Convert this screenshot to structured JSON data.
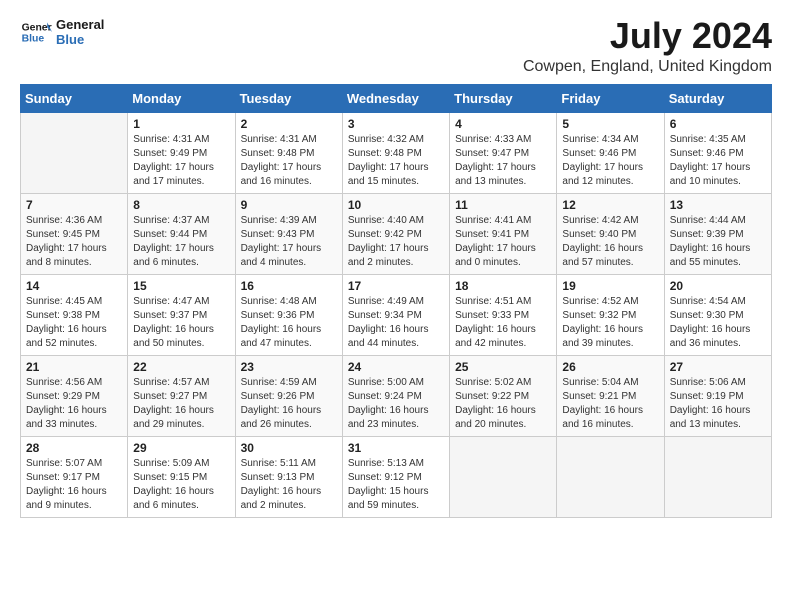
{
  "header": {
    "logo_line1": "General",
    "logo_line2": "Blue",
    "month_year": "July 2024",
    "location": "Cowpen, England, United Kingdom"
  },
  "days_of_week": [
    "Sunday",
    "Monday",
    "Tuesday",
    "Wednesday",
    "Thursday",
    "Friday",
    "Saturday"
  ],
  "weeks": [
    [
      {
        "num": "",
        "empty": true
      },
      {
        "num": "1",
        "sunrise": "Sunrise: 4:31 AM",
        "sunset": "Sunset: 9:49 PM",
        "daylight": "Daylight: 17 hours and 17 minutes."
      },
      {
        "num": "2",
        "sunrise": "Sunrise: 4:31 AM",
        "sunset": "Sunset: 9:48 PM",
        "daylight": "Daylight: 17 hours and 16 minutes."
      },
      {
        "num": "3",
        "sunrise": "Sunrise: 4:32 AM",
        "sunset": "Sunset: 9:48 PM",
        "daylight": "Daylight: 17 hours and 15 minutes."
      },
      {
        "num": "4",
        "sunrise": "Sunrise: 4:33 AM",
        "sunset": "Sunset: 9:47 PM",
        "daylight": "Daylight: 17 hours and 13 minutes."
      },
      {
        "num": "5",
        "sunrise": "Sunrise: 4:34 AM",
        "sunset": "Sunset: 9:46 PM",
        "daylight": "Daylight: 17 hours and 12 minutes."
      },
      {
        "num": "6",
        "sunrise": "Sunrise: 4:35 AM",
        "sunset": "Sunset: 9:46 PM",
        "daylight": "Daylight: 17 hours and 10 minutes."
      }
    ],
    [
      {
        "num": "7",
        "sunrise": "Sunrise: 4:36 AM",
        "sunset": "Sunset: 9:45 PM",
        "daylight": "Daylight: 17 hours and 8 minutes."
      },
      {
        "num": "8",
        "sunrise": "Sunrise: 4:37 AM",
        "sunset": "Sunset: 9:44 PM",
        "daylight": "Daylight: 17 hours and 6 minutes."
      },
      {
        "num": "9",
        "sunrise": "Sunrise: 4:39 AM",
        "sunset": "Sunset: 9:43 PM",
        "daylight": "Daylight: 17 hours and 4 minutes."
      },
      {
        "num": "10",
        "sunrise": "Sunrise: 4:40 AM",
        "sunset": "Sunset: 9:42 PM",
        "daylight": "Daylight: 17 hours and 2 minutes."
      },
      {
        "num": "11",
        "sunrise": "Sunrise: 4:41 AM",
        "sunset": "Sunset: 9:41 PM",
        "daylight": "Daylight: 17 hours and 0 minutes."
      },
      {
        "num": "12",
        "sunrise": "Sunrise: 4:42 AM",
        "sunset": "Sunset: 9:40 PM",
        "daylight": "Daylight: 16 hours and 57 minutes."
      },
      {
        "num": "13",
        "sunrise": "Sunrise: 4:44 AM",
        "sunset": "Sunset: 9:39 PM",
        "daylight": "Daylight: 16 hours and 55 minutes."
      }
    ],
    [
      {
        "num": "14",
        "sunrise": "Sunrise: 4:45 AM",
        "sunset": "Sunset: 9:38 PM",
        "daylight": "Daylight: 16 hours and 52 minutes."
      },
      {
        "num": "15",
        "sunrise": "Sunrise: 4:47 AM",
        "sunset": "Sunset: 9:37 PM",
        "daylight": "Daylight: 16 hours and 50 minutes."
      },
      {
        "num": "16",
        "sunrise": "Sunrise: 4:48 AM",
        "sunset": "Sunset: 9:36 PM",
        "daylight": "Daylight: 16 hours and 47 minutes."
      },
      {
        "num": "17",
        "sunrise": "Sunrise: 4:49 AM",
        "sunset": "Sunset: 9:34 PM",
        "daylight": "Daylight: 16 hours and 44 minutes."
      },
      {
        "num": "18",
        "sunrise": "Sunrise: 4:51 AM",
        "sunset": "Sunset: 9:33 PM",
        "daylight": "Daylight: 16 hours and 42 minutes."
      },
      {
        "num": "19",
        "sunrise": "Sunrise: 4:52 AM",
        "sunset": "Sunset: 9:32 PM",
        "daylight": "Daylight: 16 hours and 39 minutes."
      },
      {
        "num": "20",
        "sunrise": "Sunrise: 4:54 AM",
        "sunset": "Sunset: 9:30 PM",
        "daylight": "Daylight: 16 hours and 36 minutes."
      }
    ],
    [
      {
        "num": "21",
        "sunrise": "Sunrise: 4:56 AM",
        "sunset": "Sunset: 9:29 PM",
        "daylight": "Daylight: 16 hours and 33 minutes."
      },
      {
        "num": "22",
        "sunrise": "Sunrise: 4:57 AM",
        "sunset": "Sunset: 9:27 PM",
        "daylight": "Daylight: 16 hours and 29 minutes."
      },
      {
        "num": "23",
        "sunrise": "Sunrise: 4:59 AM",
        "sunset": "Sunset: 9:26 PM",
        "daylight": "Daylight: 16 hours and 26 minutes."
      },
      {
        "num": "24",
        "sunrise": "Sunrise: 5:00 AM",
        "sunset": "Sunset: 9:24 PM",
        "daylight": "Daylight: 16 hours and 23 minutes."
      },
      {
        "num": "25",
        "sunrise": "Sunrise: 5:02 AM",
        "sunset": "Sunset: 9:22 PM",
        "daylight": "Daylight: 16 hours and 20 minutes."
      },
      {
        "num": "26",
        "sunrise": "Sunrise: 5:04 AM",
        "sunset": "Sunset: 9:21 PM",
        "daylight": "Daylight: 16 hours and 16 minutes."
      },
      {
        "num": "27",
        "sunrise": "Sunrise: 5:06 AM",
        "sunset": "Sunset: 9:19 PM",
        "daylight": "Daylight: 16 hours and 13 minutes."
      }
    ],
    [
      {
        "num": "28",
        "sunrise": "Sunrise: 5:07 AM",
        "sunset": "Sunset: 9:17 PM",
        "daylight": "Daylight: 16 hours and 9 minutes."
      },
      {
        "num": "29",
        "sunrise": "Sunrise: 5:09 AM",
        "sunset": "Sunset: 9:15 PM",
        "daylight": "Daylight: 16 hours and 6 minutes."
      },
      {
        "num": "30",
        "sunrise": "Sunrise: 5:11 AM",
        "sunset": "Sunset: 9:13 PM",
        "daylight": "Daylight: 16 hours and 2 minutes."
      },
      {
        "num": "31",
        "sunrise": "Sunrise: 5:13 AM",
        "sunset": "Sunset: 9:12 PM",
        "daylight": "Daylight: 15 hours and 59 minutes."
      },
      {
        "num": "",
        "empty": true
      },
      {
        "num": "",
        "empty": true
      },
      {
        "num": "",
        "empty": true
      }
    ]
  ]
}
